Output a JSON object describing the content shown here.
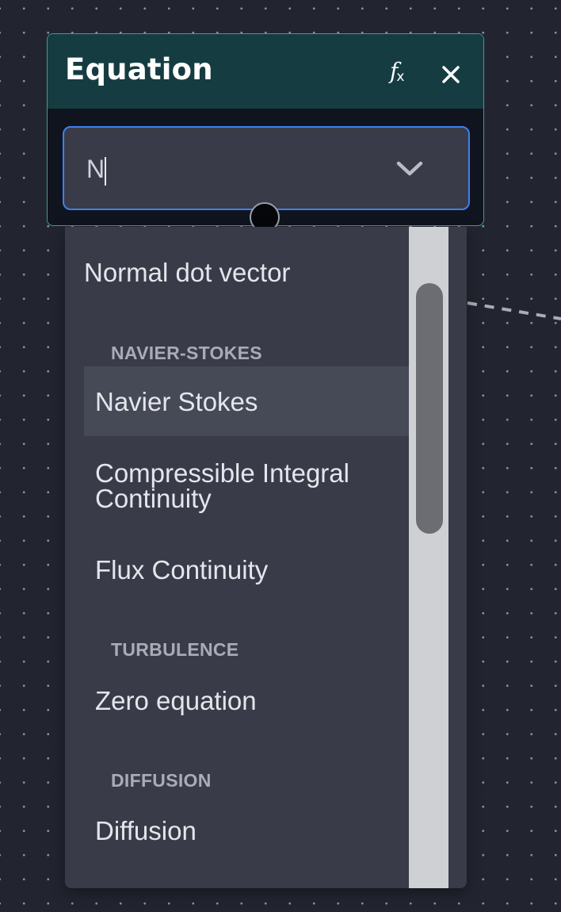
{
  "node": {
    "title": "Equation",
    "fx_icon": "fx-icon",
    "close_icon": "close-icon",
    "accent_color": "#3f9b9a",
    "header_color": "#153c41"
  },
  "select": {
    "value": "N",
    "focus_color": "#3f7ff0",
    "chevron_icon": "chevron-down-icon"
  },
  "dropdown": {
    "options": {
      "normal_dot_vector": "Normal dot vector",
      "group_navier_stokes": "NAVIER-STOKES",
      "navier_stokes": "Navier Stokes",
      "compressible_line1": "Compressible Integral",
      "compressible_line2": "Continuity",
      "flux_continuity": "Flux Continuity",
      "group_turbulence": "TURBULENCE",
      "zero_equation": "Zero equation",
      "group_diffusion": "DIFFUSION",
      "diffusion": "Diffusion"
    },
    "highlighted": "Navier Stokes"
  }
}
